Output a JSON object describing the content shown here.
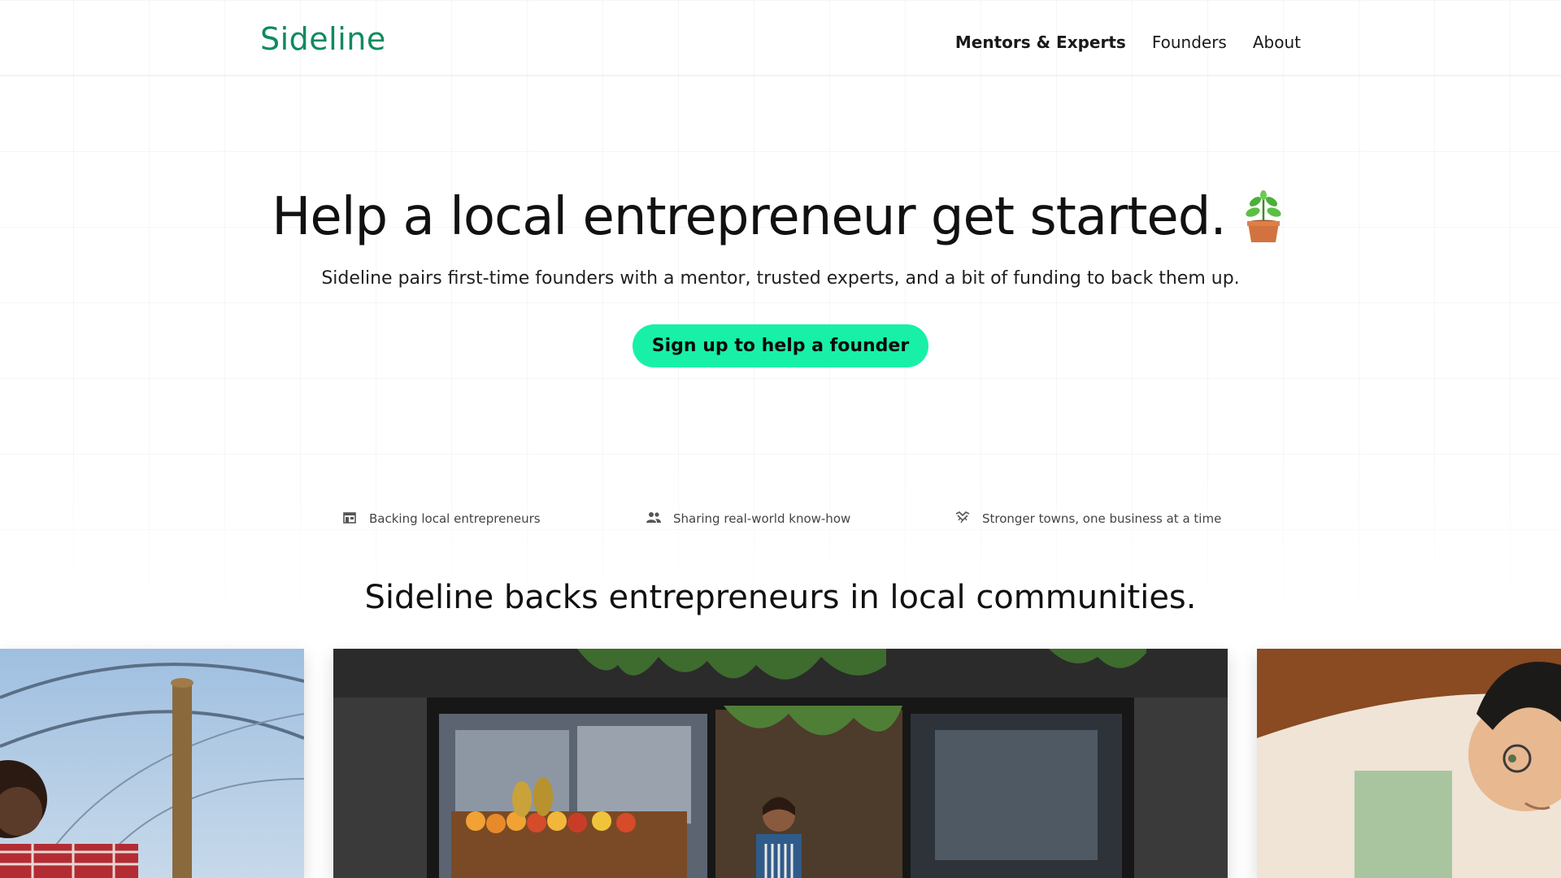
{
  "brand": {
    "name": "Sideline",
    "color": "#0f8a5f"
  },
  "nav": {
    "items": [
      {
        "label": "Mentors & Experts",
        "active": true
      },
      {
        "label": "Founders",
        "active": false
      },
      {
        "label": "About",
        "active": false
      }
    ]
  },
  "hero": {
    "title": "Help a local entrepreneur get started.",
    "title_icon": "potted-plant-icon",
    "subtitle": "Sideline pairs first-time founders with a mentor, trusted experts, and a bit of funding to back them up.",
    "cta_label": "Sign up to help a founder",
    "cta_color": "#18f0a8"
  },
  "features": [
    {
      "icon": "storefront-icon",
      "label": "Backing local entrepreneurs"
    },
    {
      "icon": "people-icon",
      "label": "Sharing real-world know-how"
    },
    {
      "icon": "handshake-icon",
      "label": "Stronger towns, one business at a time"
    }
  ],
  "section": {
    "title": "Sideline backs entrepreneurs in local communities."
  },
  "gallery": {
    "photos": [
      {
        "name": "photo-greenhouse-farmer"
      },
      {
        "name": "photo-grocery-shop-owner"
      },
      {
        "name": "photo-man-with-glasses"
      }
    ]
  }
}
